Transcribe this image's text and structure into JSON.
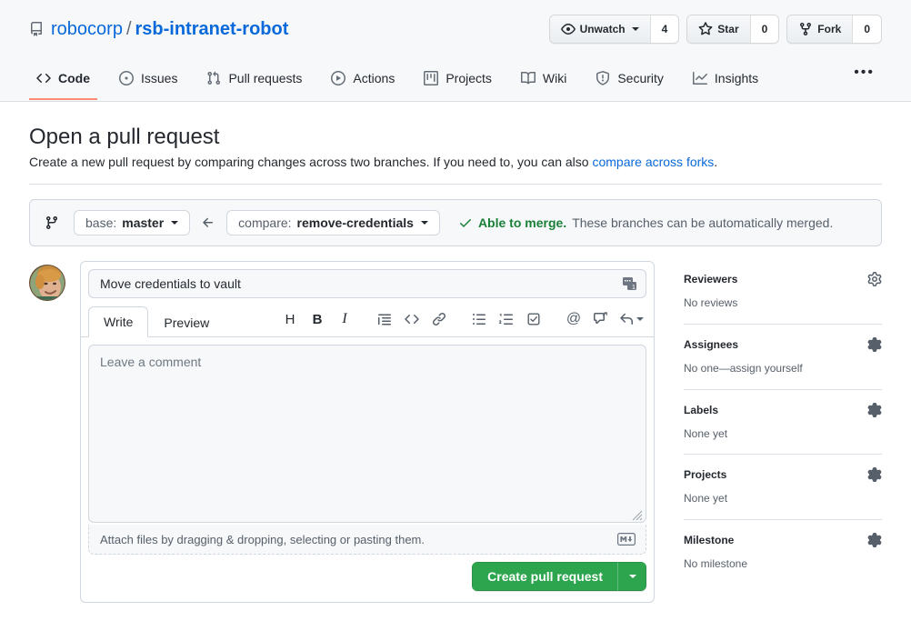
{
  "repo": {
    "owner": "robocorp",
    "separator": "/",
    "name": "rsb-intranet-robot",
    "icon": "repo-icon"
  },
  "header_actions": [
    {
      "label": "Unwatch",
      "count": "4",
      "icon": "eye-icon",
      "has_caret": true
    },
    {
      "label": "Star",
      "count": "0",
      "icon": "star-icon",
      "has_caret": false
    },
    {
      "label": "Fork",
      "count": "0",
      "icon": "fork-icon",
      "has_caret": false
    }
  ],
  "nav": {
    "tabs": [
      {
        "label": "Code",
        "icon": "code-icon",
        "selected": true
      },
      {
        "label": "Issues",
        "icon": "issue-opened-icon",
        "selected": false
      },
      {
        "label": "Pull requests",
        "icon": "git-pull-request-icon",
        "selected": false
      },
      {
        "label": "Actions",
        "icon": "play-icon",
        "selected": false
      },
      {
        "label": "Projects",
        "icon": "project-icon",
        "selected": false
      },
      {
        "label": "Wiki",
        "icon": "book-icon",
        "selected": false
      },
      {
        "label": "Security",
        "icon": "shield-icon",
        "selected": false
      },
      {
        "label": "Insights",
        "icon": "graph-icon",
        "selected": false
      }
    ],
    "more_label": "•••"
  },
  "page": {
    "title": "Open a pull request",
    "subtitle_text": "Create a new pull request by comparing changes across two branches. If you need to, you can also ",
    "subtitle_link": "compare across forks",
    "subtitle_tail": "."
  },
  "compare": {
    "icon": "git-compare-icon",
    "base_prefix": "base:",
    "base_branch": "master",
    "arrow": "arrow-left-icon",
    "compare_prefix": "compare:",
    "compare_branch": "remove-credentials",
    "status_icon": "check-icon",
    "status_strong": "Able to merge.",
    "status_text": "These branches can be automatically merged."
  },
  "form": {
    "avatar_name": "user-avatar",
    "title_value": "Move credentials to vault",
    "title_placeholder": "Title",
    "title_badge_icon": "saved-replies-badge-icon",
    "tabs": [
      {
        "label": "Write",
        "active": true
      },
      {
        "label": "Preview",
        "active": false
      }
    ],
    "toolbar": [
      {
        "name": "heading",
        "glyph": "H",
        "kind": "head"
      },
      {
        "name": "bold",
        "glyph": "B",
        "kind": "bold"
      },
      {
        "name": "italic",
        "glyph": "I",
        "kind": "ital"
      },
      {
        "name": "quote",
        "glyph": "",
        "kind": "svg-quote"
      },
      {
        "name": "code",
        "glyph": "",
        "kind": "svg-code"
      },
      {
        "name": "link",
        "glyph": "",
        "kind": "svg-link"
      },
      {
        "name": "unordered-list",
        "glyph": "",
        "kind": "svg-ul"
      },
      {
        "name": "ordered-list",
        "glyph": "",
        "kind": "svg-ol"
      },
      {
        "name": "task-list",
        "glyph": "",
        "kind": "svg-task"
      },
      {
        "name": "mention",
        "glyph": "@",
        "kind": "at"
      },
      {
        "name": "saved-replies",
        "glyph": "",
        "kind": "svg-reply-box"
      },
      {
        "name": "reference",
        "glyph": "",
        "kind": "svg-reply"
      }
    ],
    "comment_placeholder": "Leave a comment",
    "comment_value": "",
    "attach_text": "Attach files by dragging & dropping, selecting or pasting them.",
    "markdown_badge": "markdown-icon",
    "submit_label": "Create pull request",
    "submit_caret_icon": "chevron-down-icon",
    "submit_color": "#2da44e"
  },
  "sidebar": {
    "sections": [
      {
        "title": "Reviewers",
        "body": "No reviews",
        "gear": "gear-icon"
      },
      {
        "title": "Assignees",
        "body": "No one—assign yourself",
        "gear": "gear-icon"
      },
      {
        "title": "Labels",
        "body": "None yet",
        "gear": "gear-icon"
      },
      {
        "title": "Projects",
        "body": "None yet",
        "gear": "gear-icon"
      },
      {
        "title": "Milestone",
        "body": "No milestone",
        "gear": "gear-icon"
      }
    ]
  },
  "colors": {
    "link": "#0969da",
    "success": "#1a7f37",
    "accent_underline": "#fd8c73",
    "header_bg": "#f6f8fa",
    "border": "#d0d7de"
  }
}
